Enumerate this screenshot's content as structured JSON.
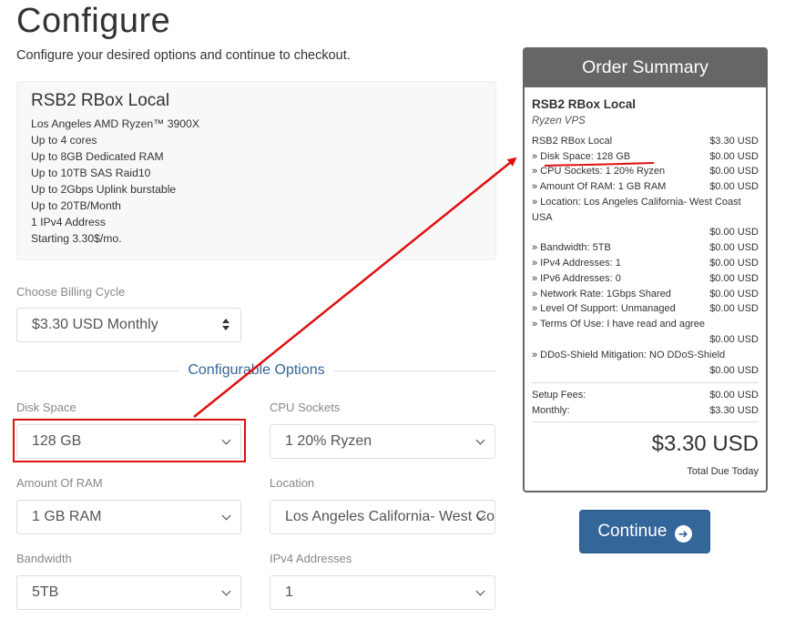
{
  "page": {
    "title": "Configure",
    "subtitle": "Configure your desired options and continue to checkout."
  },
  "product": {
    "name": "RSB2 RBox Local",
    "features": [
      "Los Angeles AMD Ryzen™ 3900X",
      "Up to 4 cores",
      "Up to 8GB Dedicated RAM",
      "Up to 10TB SAS Raid10",
      "Up to 2Gbps Uplink burstable",
      "Up to 20TB/Month",
      "1 IPv4 Address",
      "Starting 3.30$/mo."
    ]
  },
  "billing": {
    "label": "Choose Billing Cycle",
    "value": "$3.30 USD Monthly"
  },
  "configurable_heading": "Configurable Options",
  "options": {
    "disk_space": {
      "label": "Disk Space",
      "value": "128 GB"
    },
    "cpu_sockets": {
      "label": "CPU Sockets",
      "value": "1 20% Ryzen"
    },
    "ram": {
      "label": "Amount Of RAM",
      "value": "1 GB RAM"
    },
    "location": {
      "label": "Location",
      "value": "Los Angeles California- West Coast USA"
    },
    "bandwidth": {
      "label": "Bandwidth",
      "value": "5TB"
    },
    "ipv4": {
      "label": "IPv4 Addresses",
      "value": "1"
    }
  },
  "summary": {
    "title": "Order Summary",
    "product_name": "RSB2 RBox Local",
    "product_group": "Ryzen VPS",
    "rows": [
      {
        "label": "RSB2 RBox Local",
        "price": "$3.30 USD"
      },
      {
        "label": "» Disk Space: 128 GB",
        "price": "$0.00 USD"
      },
      {
        "label": "» CPU Sockets: 1 20% Ryzen",
        "price": "$0.00 USD"
      },
      {
        "label": "» Amount Of RAM: 1 GB RAM",
        "price": "$0.00 USD"
      },
      {
        "label": "» Location: Los Angeles California- West Coast USA",
        "price": "$0.00 USD"
      },
      {
        "label": "» Bandwidth: 5TB",
        "price": "$0.00 USD"
      },
      {
        "label": "» IPv4 Addresses: 1",
        "price": "$0.00 USD"
      },
      {
        "label": "» IPv6 Addresses: 0",
        "price": "$0.00 USD"
      },
      {
        "label": "» Network Rate: 1Gbps Shared",
        "price": "$0.00 USD"
      },
      {
        "label": "» Level Of Support: Unmanaged",
        "price": "$0.00 USD"
      },
      {
        "label": "» Terms Of Use: I have read and agree",
        "price": "$0.00 USD"
      },
      {
        "label": "» DDoS-Shield Mitigation: NO DDoS-Shield",
        "price": "$0.00 USD"
      }
    ],
    "setup_fees": {
      "label": "Setup Fees:",
      "price": "$0.00 USD"
    },
    "monthly": {
      "label": "Monthly:",
      "price": "$3.30 USD"
    },
    "total": "$3.30 USD",
    "total_label": "Total Due Today"
  },
  "continue_button": {
    "label": "Continue",
    "icon": "arrow-circle-right-icon"
  },
  "annotation": {
    "color": "#e01010"
  },
  "colors": {
    "accent": "#336699",
    "summary_header": "#666666"
  }
}
